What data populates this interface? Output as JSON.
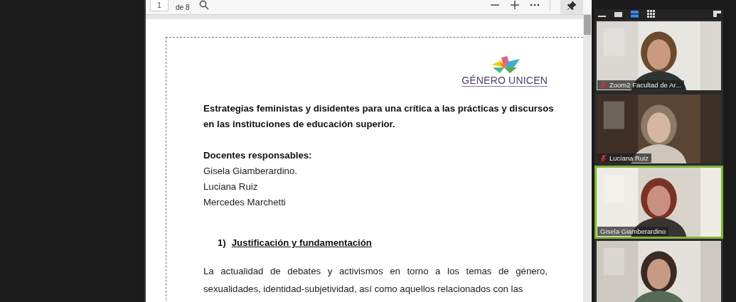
{
  "pdf_viewer": {
    "page_number": "1",
    "page_count": "de 8",
    "document": {
      "logo_text": "GÉNERO UNICEN",
      "title": "Estrategias feministas y disidentes para una crítica a las prácticas y discursos en las instituciones de educación superior.",
      "responsables_heading": "Docentes responsables:",
      "responsables": [
        "Gisela Giamberardino.",
        "Luciana Ruiz",
        "Mercedes Marchetti"
      ],
      "section_number": "1)",
      "section_heading": "Justificación y fundamentación",
      "paragraph": "La actualidad de debates y activismos en torno a los temas de género, sexualidades, identidad-subjetividad, así como aquellos relacionados con las"
    }
  },
  "video_panel": {
    "view_modes": [
      {
        "kind": "minimize",
        "selected": false
      },
      {
        "kind": "small",
        "selected": false
      },
      {
        "kind": "speaker",
        "selected": true
      },
      {
        "kind": "gallery",
        "selected": false
      }
    ],
    "participants": [
      {
        "name": "Zoom2 Facultad de Ar...",
        "muted": true,
        "selected": false
      },
      {
        "name": "Luciana Ruiz",
        "muted": true,
        "selected": false
      },
      {
        "name": "Gisela Giamberardino",
        "muted": false,
        "selected": true
      },
      {
        "selected": false
      }
    ]
  }
}
